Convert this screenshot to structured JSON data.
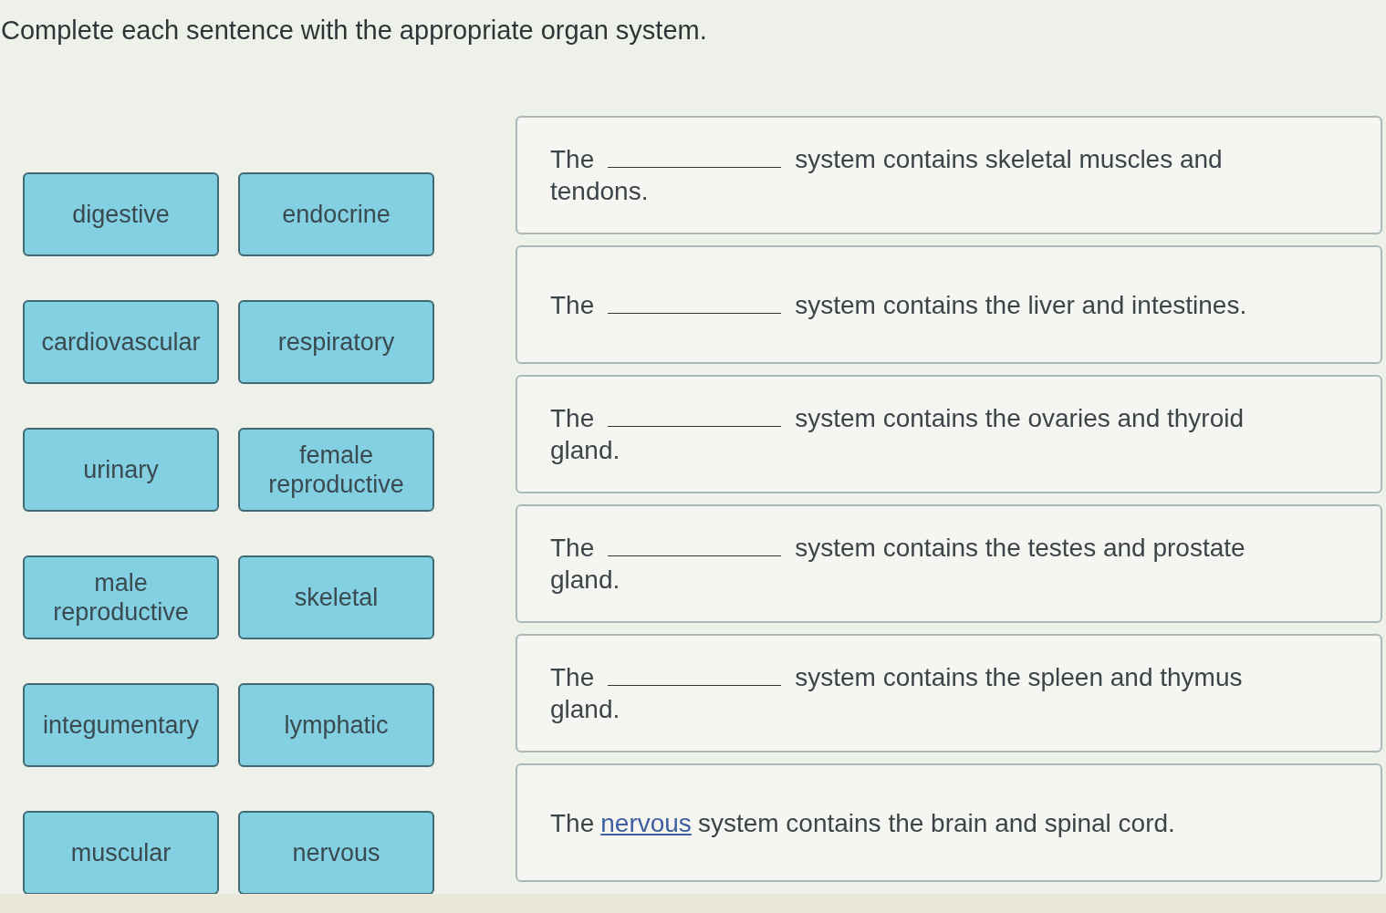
{
  "instruction": "Complete each sentence with the appropriate organ system.",
  "choices": [
    "digestive",
    "endocrine",
    "cardiovascular",
    "respiratory",
    "urinary",
    "female reproductive",
    "male reproductive",
    "skeletal",
    "integumentary",
    "lymphatic",
    "muscular",
    "nervous"
  ],
  "sentences": [
    {
      "start": "The",
      "after": "system contains skeletal muscles and tendons."
    },
    {
      "start": "The",
      "after": "system contains the liver and intestines."
    },
    {
      "start": "The",
      "after": "system contains the ovaries and thyroid gland."
    },
    {
      "start": "The",
      "after": "system contains the testes and prostate gland."
    },
    {
      "start": "The",
      "after": "system contains the spleen and thymus gland."
    },
    {
      "start": "The",
      "answer": "nervous",
      "after": "system contains the brain and spinal cord."
    }
  ]
}
